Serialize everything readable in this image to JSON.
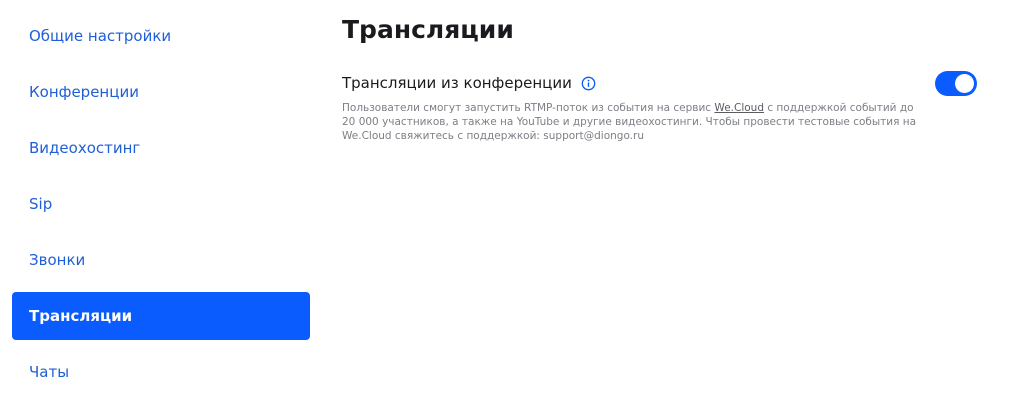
{
  "sidebar": {
    "items": [
      {
        "label": "Общие настройки"
      },
      {
        "label": "Конференции"
      },
      {
        "label": "Видеохостинг"
      },
      {
        "label": "Sip"
      },
      {
        "label": "Звонки"
      },
      {
        "label": "Трансляции"
      },
      {
        "label": "Чаты"
      }
    ],
    "active_index": 5
  },
  "main": {
    "title": "Трансляции",
    "setting": {
      "title": "Трансляции из конференции",
      "info_icon": "info-icon",
      "description_before_link": "Пользователи смогут запустить RTMP-поток из события на сервис ",
      "link_text": "We.Cloud",
      "description_after_link": " с поддержкой событий до 20 000 участников, а также на YouTube и другие видеохостинги. Чтобы провести тестовые события на We.Cloud свяжитесь с поддержкой: support@diongo.ru",
      "toggle_enabled": true
    }
  },
  "colors": {
    "accent": "#0a5cff",
    "link": "#1f5fd6",
    "text": "#1b1b1f",
    "muted": "#7d7f86"
  }
}
